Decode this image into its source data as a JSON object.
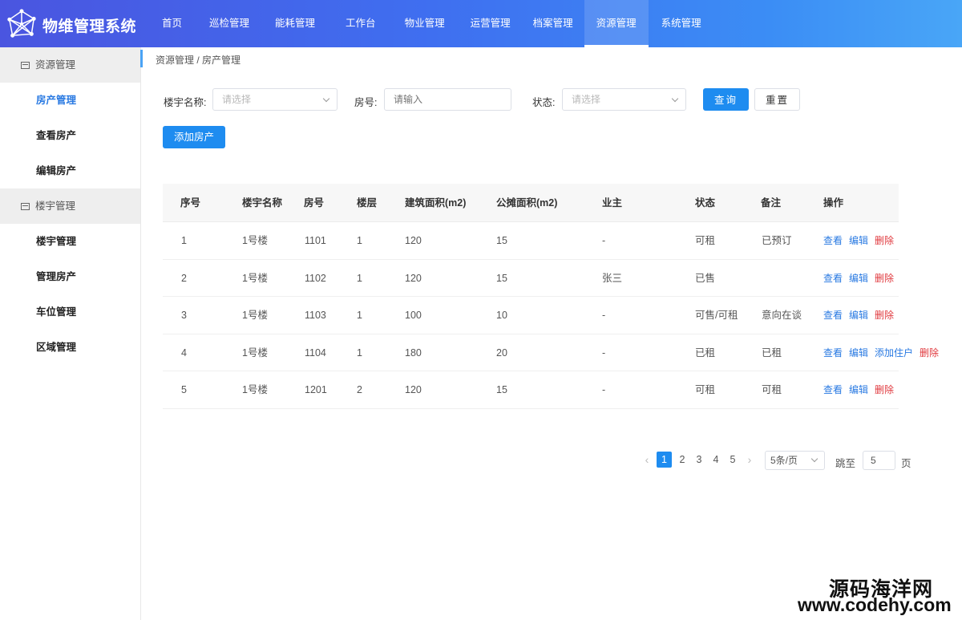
{
  "header": {
    "app_title": "物维管理系统",
    "nav": [
      "首页",
      "巡检管理",
      "能耗管理",
      "工作台",
      "物业管理",
      "运营管理",
      "档案管理",
      "资源管理",
      "系统管理"
    ],
    "active_nav": "资源管理"
  },
  "sidebar": {
    "group1": "资源管理",
    "group1_items": [
      "房产管理",
      "查看房产",
      "编辑房产"
    ],
    "group2": "楼宇管理",
    "group2_items": [
      "楼宇管理",
      "管理房产",
      "车位管理",
      "区域管理"
    ],
    "active_item": "房产管理"
  },
  "breadcrumb": "资源管理 / 房产管理",
  "filters": {
    "building_label": "楼宇名称:",
    "building_placeholder": "请选择",
    "room_label": "房号:",
    "room_placeholder": "请输入",
    "status_label": "状态:",
    "status_placeholder": "请选择",
    "query_button": "查询",
    "reset_button": "重置"
  },
  "add_button": "添加房产",
  "table": {
    "headers": [
      "序号",
      "楼宇名称",
      "房号",
      "楼层",
      "建筑面积(m2)",
      "公摊面积(m2)",
      "业主",
      "状态",
      "备注",
      "操作"
    ],
    "rows": [
      {
        "no": "1",
        "building": "1号楼",
        "room": "1101",
        "floor": "1",
        "area": "120",
        "shared": "15",
        "owner": "-",
        "status": "可租",
        "note": "已预订",
        "ops": [
          "查看",
          "编辑",
          "删除"
        ]
      },
      {
        "no": "2",
        "building": "1号楼",
        "room": "1102",
        "floor": "1",
        "area": "120",
        "shared": "15",
        "owner": "张三",
        "status": "已售",
        "note": "",
        "ops": [
          "查看",
          "编辑",
          "删除"
        ]
      },
      {
        "no": "3",
        "building": "1号楼",
        "room": "1103",
        "floor": "1",
        "area": "100",
        "shared": "10",
        "owner": "-",
        "status": "可售/可租",
        "note": "意向在谈",
        "ops": [
          "查看",
          "编辑",
          "删除"
        ]
      },
      {
        "no": "4",
        "building": "1号楼",
        "room": "1104",
        "floor": "1",
        "area": "180",
        "shared": "20",
        "owner": "-",
        "status": "已租",
        "note": "已租",
        "ops": [
          "查看",
          "编辑",
          "添加住户",
          "删除"
        ]
      },
      {
        "no": "5",
        "building": "1号楼",
        "room": "1201",
        "floor": "2",
        "area": "120",
        "shared": "15",
        "owner": "-",
        "status": "可租",
        "note": "可租",
        "ops": [
          "查看",
          "编辑",
          "删除"
        ]
      }
    ]
  },
  "pagination": {
    "prev": "‹",
    "next": "›",
    "pages": [
      "1",
      "2",
      "3",
      "4",
      "5"
    ],
    "current": "1",
    "page_size": "5条/页",
    "jump_label": "跳至",
    "jump_value": "5",
    "page_unit": "页"
  },
  "watermark": {
    "line1": "源码海洋网",
    "line2": "www.codehy.com"
  }
}
